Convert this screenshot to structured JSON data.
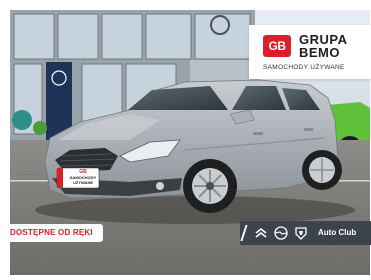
{
  "dealer": {
    "logo_initials": "GB",
    "name_line1": "GRUPA",
    "name_line2": "BEMO",
    "subtitle": "SAMOCHODY UŻYWANE"
  },
  "badge": {
    "available": "DOSTĘPNE OD RĘKI"
  },
  "footer": {
    "icons": [
      "citroen-logo-icon",
      "opel-logo-icon",
      "peugeot-logo-icon"
    ],
    "auto_club": "Auto Club"
  },
  "plate": {
    "line1": "GB",
    "line2": "SAMOCHODY",
    "line3": "UŻYWANE"
  },
  "colors": {
    "brand_red": "#d9202b",
    "car_silver": "#aeb3b9",
    "footer_bar": "#3c434c"
  }
}
